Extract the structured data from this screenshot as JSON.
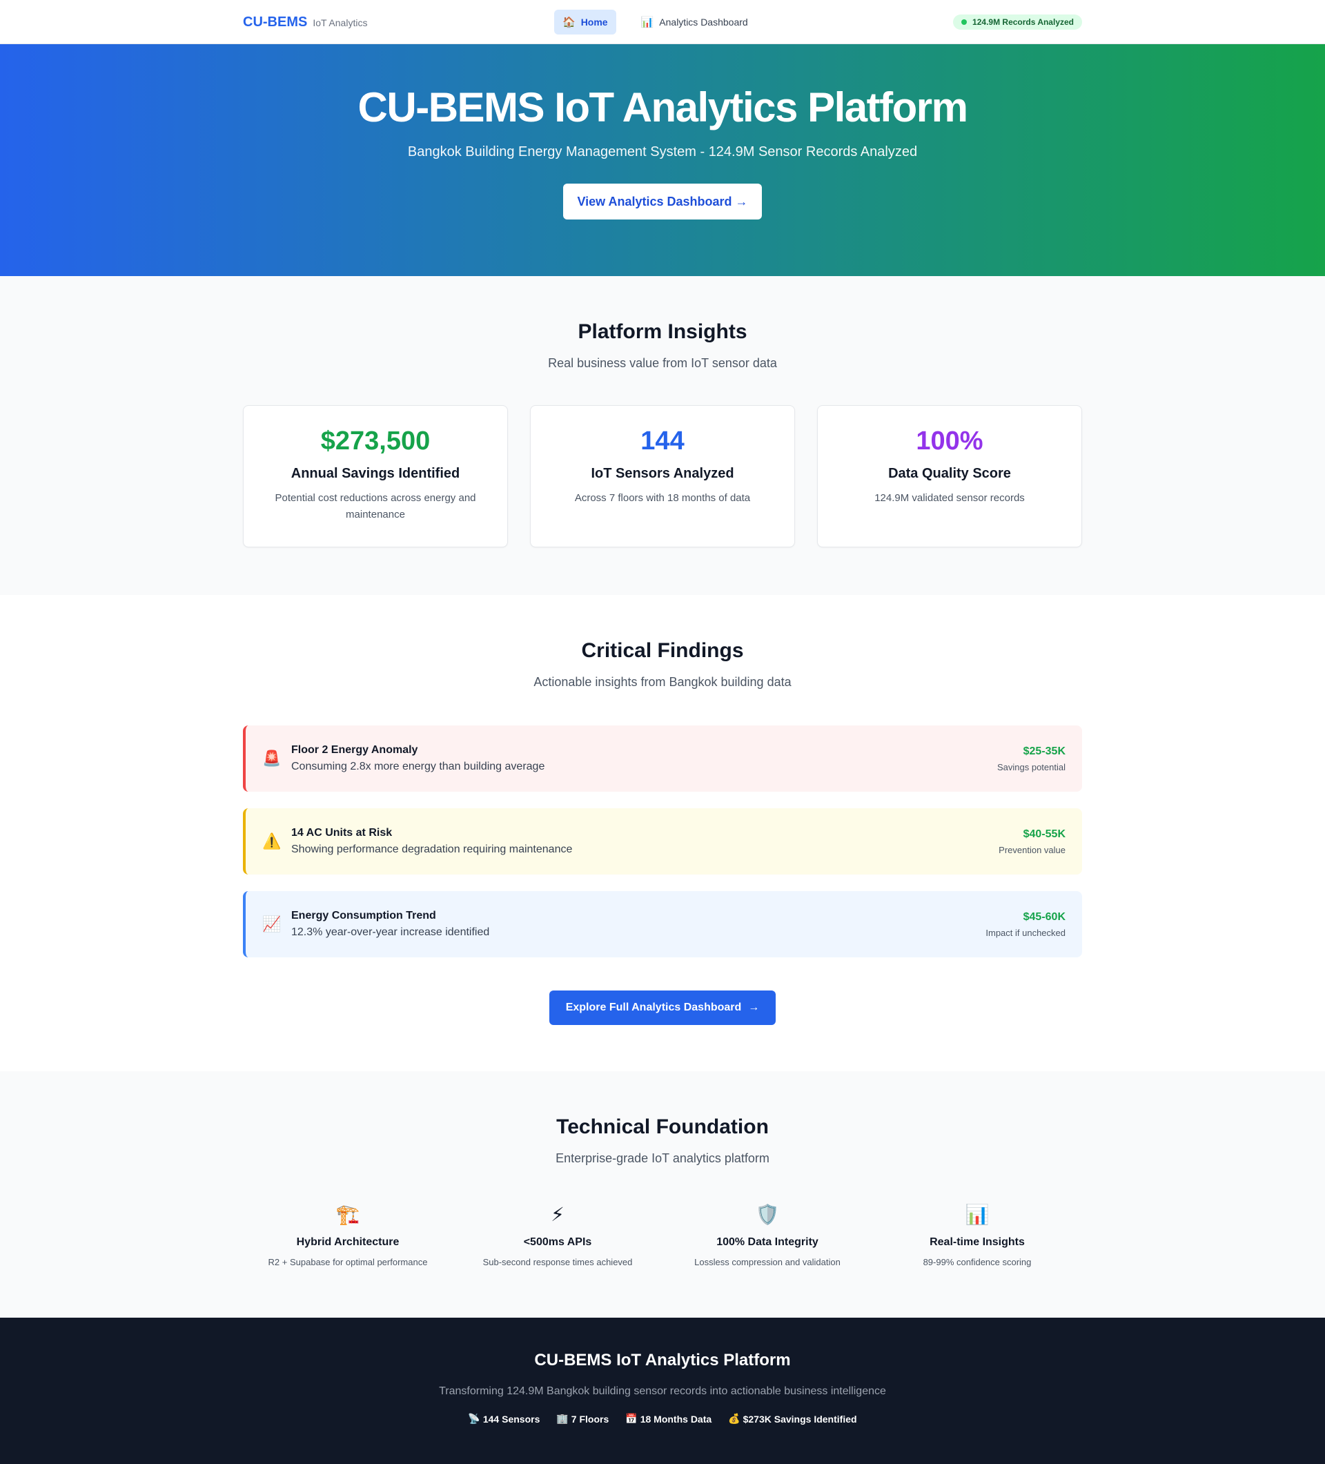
{
  "nav": {
    "brand": "CU-BEMS",
    "brand_sub": "IoT Analytics",
    "links": [
      {
        "icon": "🏠",
        "label": "Home"
      },
      {
        "icon": "📊",
        "label": "Analytics Dashboard"
      }
    ],
    "records_badge": "124.9M Records Analyzed"
  },
  "hero": {
    "title": "CU-BEMS IoT Analytics Platform",
    "subtitle": "Bangkok Building Energy Management System - 124.9M Sensor Records Analyzed",
    "cta": "View Analytics Dashboard →"
  },
  "insights": {
    "title": "Platform Insights",
    "subtitle": "Real business value from IoT sensor data",
    "cards": [
      {
        "value": "$273,500",
        "title": "Annual Savings Identified",
        "desc": "Potential cost reductions across energy and maintenance",
        "color": "#16a34a"
      },
      {
        "value": "144",
        "title": "IoT Sensors Analyzed",
        "desc": "Across 7 floors with 18 months of data",
        "color": "#2563eb"
      },
      {
        "value": "100%",
        "title": "Data Quality Score",
        "desc": "124.9M validated sensor records",
        "color": "#9333ea"
      }
    ]
  },
  "findings": {
    "title": "Critical Findings",
    "subtitle": "Actionable insights from Bangkok building data",
    "items": [
      {
        "icon": "🚨",
        "title": "Floor 2 Energy Anomaly",
        "desc": "Consuming 2.8x more energy than building average",
        "value": "$25-35K",
        "caption": "Savings potential"
      },
      {
        "icon": "⚠️",
        "title": "14 AC Units at Risk",
        "desc": "Showing performance degradation requiring maintenance",
        "value": "$40-55K",
        "caption": "Prevention value"
      },
      {
        "icon": "📈",
        "title": "Energy Consumption Trend",
        "desc": "12.3% year-over-year increase identified",
        "value": "$45-60K",
        "caption": "Impact if unchecked"
      }
    ],
    "cta": "Explore Full Analytics Dashboard",
    "cta_arrow": "→"
  },
  "tech": {
    "title": "Technical Foundation",
    "subtitle": "Enterprise-grade IoT analytics platform",
    "features": [
      {
        "icon": "🏗️",
        "title": "Hybrid Architecture",
        "desc": "R2 + Supabase for optimal performance"
      },
      {
        "icon": "⚡",
        "title": "<500ms APIs",
        "desc": "Sub-second response times achieved"
      },
      {
        "icon": "🛡️",
        "title": "100% Data Integrity",
        "desc": "Lossless compression and validation"
      },
      {
        "icon": "📊",
        "title": "Real-time Insights",
        "desc": "89-99% confidence scoring"
      }
    ]
  },
  "footer": {
    "title": "CU-BEMS IoT Analytics Platform",
    "subtitle": "Transforming 124.9M Bangkok building sensor records into actionable business intelligence",
    "stats": [
      {
        "icon": "📡",
        "label": "144 Sensors"
      },
      {
        "icon": "🏢",
        "label": "7 Floors"
      },
      {
        "icon": "📅",
        "label": "18 Months Data"
      },
      {
        "icon": "💰",
        "label": "$273K Savings Identified"
      }
    ]
  }
}
